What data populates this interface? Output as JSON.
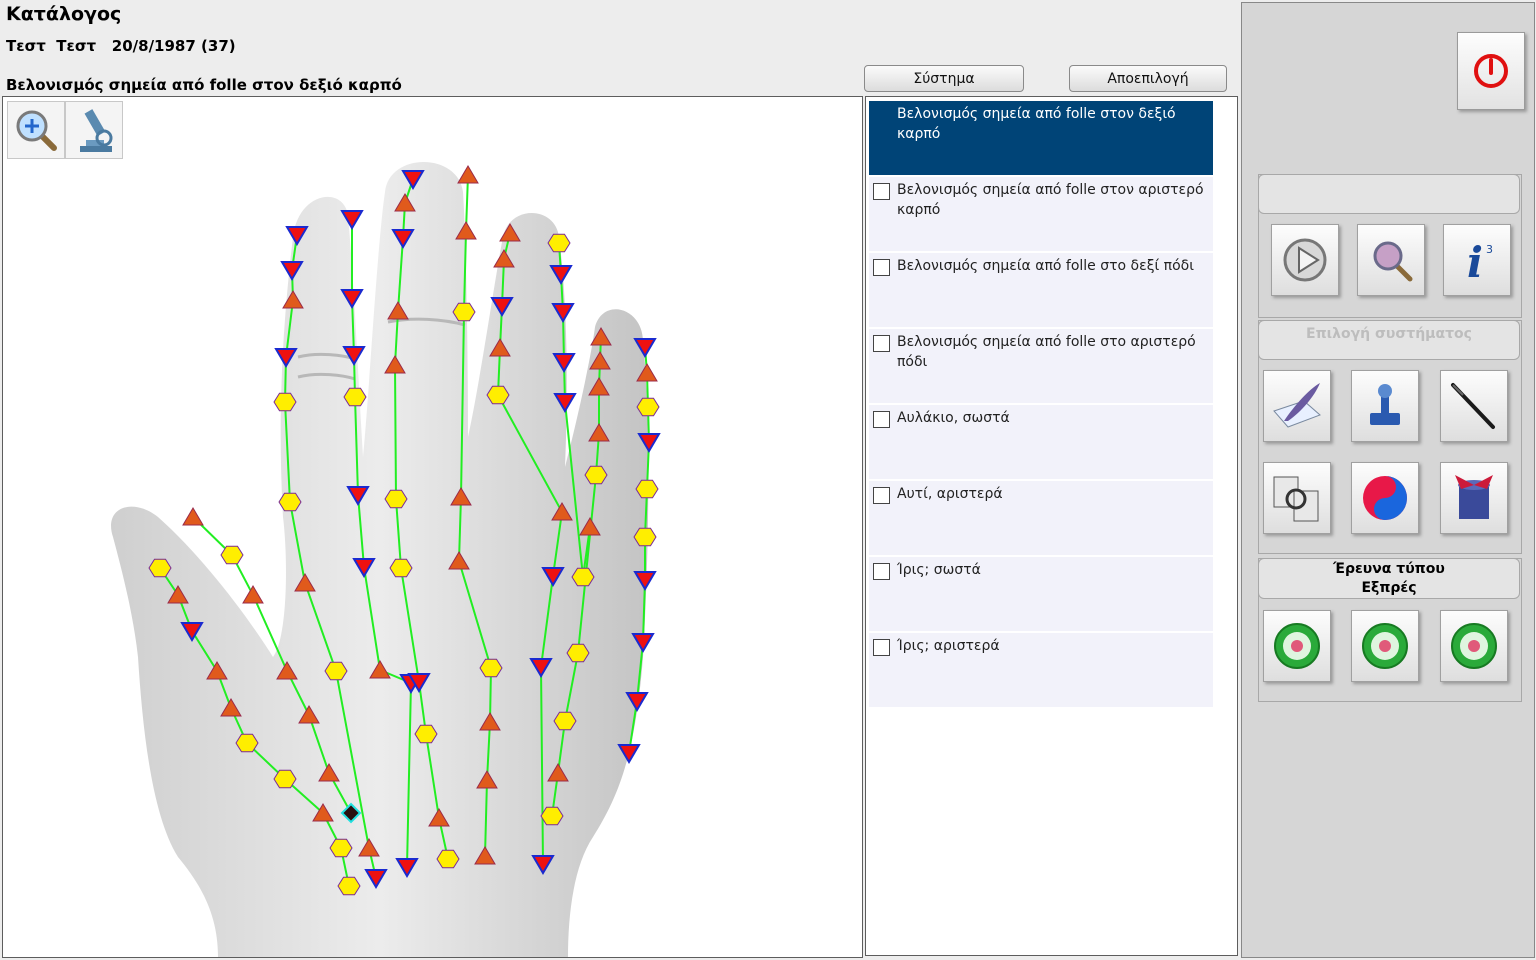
{
  "header": {
    "title": "Κατάλογος",
    "patient": "Τεστ  Τεστ   20/8/1987 (37)",
    "chart_title": "Βελονισμός σημεία από folle στον δεξιό καρπό"
  },
  "buttons": {
    "system": "Σύστημα",
    "deselect": "Αποεπιλογή"
  },
  "list": {
    "items": [
      {
        "label": "Βελονισμός σημεία από folle στον δεξιό καρπό",
        "selected": true
      },
      {
        "label": "Βελονισμός σημεία από folle στον αριστερό καρπό",
        "selected": false
      },
      {
        "label": "Βελονισμός σημεία από folle στο δεξί πόδι",
        "selected": false
      },
      {
        "label": "Βελονισμός σημεία από folle στο αριστερό πόδι",
        "selected": false
      },
      {
        "label": "Αυλάκιο, σωστά",
        "selected": false
      },
      {
        "label": "Αυτί, αριστερά",
        "selected": false
      },
      {
        "label": "Ίρις; σωστά",
        "selected": false
      },
      {
        "label": "Ίρις; αριστερά",
        "selected": false
      }
    ]
  },
  "right_panel": {
    "system_select_label": "Επιλογή συστήματος",
    "express_label": "Έρευνα τύπου Εξπρές"
  },
  "colors": {
    "selected_bg": "#004477",
    "line": "#22ee22",
    "hexagon": "#ffee00",
    "triangle_up": "#e05a1c",
    "triangle_down": "#ee1111",
    "power_red": "#e01010"
  }
}
